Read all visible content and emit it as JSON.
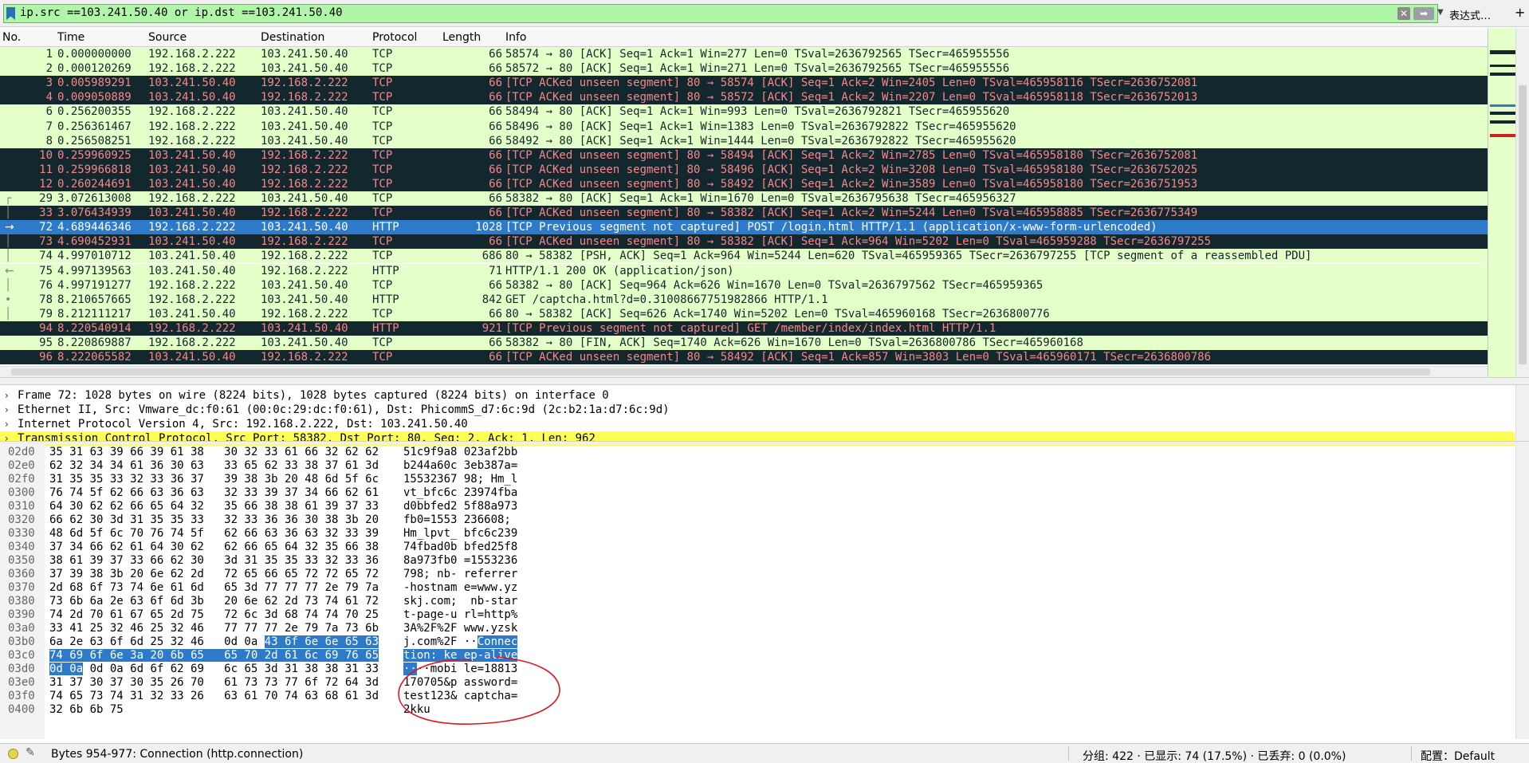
{
  "filter": {
    "text": "ip.src ==103.241.50.40 or ip.dst ==103.241.50.40",
    "expression_label": "表达式…",
    "plus_label": "+"
  },
  "packet_list": {
    "columns": [
      "No.",
      "Time",
      "Source",
      "Destination",
      "Protocol",
      "Length",
      "Info"
    ],
    "rows": [
      {
        "no": "1",
        "time": "0.000000000",
        "src": "192.168.2.222",
        "dst": "103.241.50.40",
        "proto": "TCP",
        "len": "66",
        "info": "58574 → 80 [ACK] Seq=1 Ack=1 Win=277 Len=0 TSval=2636792565 TSecr=465955556",
        "style": "green"
      },
      {
        "no": "2",
        "time": "0.000120269",
        "src": "192.168.2.222",
        "dst": "103.241.50.40",
        "proto": "TCP",
        "len": "66",
        "info": "58572 → 80 [ACK] Seq=1 Ack=1 Win=271 Len=0 TSval=2636792565 TSecr=465955556",
        "style": "green"
      },
      {
        "no": "3",
        "time": "0.005989291",
        "src": "103.241.50.40",
        "dst": "192.168.2.222",
        "proto": "TCP",
        "len": "66",
        "info": "[TCP ACKed unseen segment] 80 → 58574 [ACK] Seq=1 Ack=2 Win=2405 Len=0 TSval=465958116 TSecr=2636752081",
        "style": "dark"
      },
      {
        "no": "4",
        "time": "0.009050889",
        "src": "103.241.50.40",
        "dst": "192.168.2.222",
        "proto": "TCP",
        "len": "66",
        "info": "[TCP ACKed unseen segment] 80 → 58572 [ACK] Seq=1 Ack=2 Win=2207 Len=0 TSval=465958118 TSecr=2636752013",
        "style": "dark"
      },
      {
        "no": "6",
        "time": "0.256200355",
        "src": "192.168.2.222",
        "dst": "103.241.50.40",
        "proto": "TCP",
        "len": "66",
        "info": "58494 → 80 [ACK] Seq=1 Ack=1 Win=993 Len=0 TSval=2636792821 TSecr=465955620",
        "style": "green"
      },
      {
        "no": "7",
        "time": "0.256361467",
        "src": "192.168.2.222",
        "dst": "103.241.50.40",
        "proto": "TCP",
        "len": "66",
        "info": "58496 → 80 [ACK] Seq=1 Ack=1 Win=1383 Len=0 TSval=2636792822 TSecr=465955620",
        "style": "green"
      },
      {
        "no": "8",
        "time": "0.256508251",
        "src": "192.168.2.222",
        "dst": "103.241.50.40",
        "proto": "TCP",
        "len": "66",
        "info": "58492 → 80 [ACK] Seq=1 Ack=1 Win=1444 Len=0 TSval=2636792822 TSecr=465955620",
        "style": "green"
      },
      {
        "no": "10",
        "time": "0.259960925",
        "src": "103.241.50.40",
        "dst": "192.168.2.222",
        "proto": "TCP",
        "len": "66",
        "info": "[TCP ACKed unseen segment] 80 → 58494 [ACK] Seq=1 Ack=2 Win=2785 Len=0 TSval=465958180 TSecr=2636752081",
        "style": "dark"
      },
      {
        "no": "11",
        "time": "0.259966818",
        "src": "103.241.50.40",
        "dst": "192.168.2.222",
        "proto": "TCP",
        "len": "66",
        "info": "[TCP ACKed unseen segment] 80 → 58496 [ACK] Seq=1 Ack=2 Win=3208 Len=0 TSval=465958180 TSecr=2636752025",
        "style": "dark"
      },
      {
        "no": "12",
        "time": "0.260244691",
        "src": "103.241.50.40",
        "dst": "192.168.2.222",
        "proto": "TCP",
        "len": "66",
        "info": "[TCP ACKed unseen segment] 80 → 58492 [ACK] Seq=1 Ack=2 Win=3589 Len=0 TSval=465958180 TSecr=2636751953",
        "style": "dark"
      },
      {
        "no": "29",
        "time": "3.072613008",
        "src": "192.168.2.222",
        "dst": "103.241.50.40",
        "proto": "TCP",
        "len": "66",
        "info": "58382 → 80 [ACK] Seq=1 Ack=1 Win=1670 Len=0 TSval=2636795638 TSecr=465956327",
        "style": "green"
      },
      {
        "no": "33",
        "time": "3.076434939",
        "src": "103.241.50.40",
        "dst": "192.168.2.222",
        "proto": "TCP",
        "len": "66",
        "info": "[TCP ACKed unseen segment] 80 → 58382 [ACK] Seq=1 Ack=2 Win=5244 Len=0 TSval=465958885 TSecr=2636775349",
        "style": "dark"
      },
      {
        "no": "72",
        "time": "4.689446346",
        "src": "192.168.2.222",
        "dst": "103.241.50.40",
        "proto": "HTTP",
        "len": "1028",
        "info": "[TCP Previous segment not captured] POST /login.html HTTP/1.1  (application/x-www-form-urlencoded)",
        "style": "sel"
      },
      {
        "no": "73",
        "time": "4.690452931",
        "src": "103.241.50.40",
        "dst": "192.168.2.222",
        "proto": "TCP",
        "len": "66",
        "info": "[TCP ACKed unseen segment] 80 → 58382 [ACK] Seq=1 Ack=964 Win=5202 Len=0 TSval=465959288 TSecr=2636797255",
        "style": "dark"
      },
      {
        "no": "74",
        "time": "4.997010712",
        "src": "103.241.50.40",
        "dst": "192.168.2.222",
        "proto": "TCP",
        "len": "686",
        "info": "80 → 58382 [PSH, ACK] Seq=1 Ack=964 Win=5244 Len=620 TSval=465959365 TSecr=2636797255 [TCP segment of a reassembled PDU]",
        "style": "green"
      },
      {
        "no": "75",
        "time": "4.997139563",
        "src": "103.241.50.40",
        "dst": "192.168.2.222",
        "proto": "HTTP",
        "len": "71",
        "info": "HTTP/1.1 200 OK  (application/json)",
        "style": "green"
      },
      {
        "no": "76",
        "time": "4.997191277",
        "src": "192.168.2.222",
        "dst": "103.241.50.40",
        "proto": "TCP",
        "len": "66",
        "info": "58382 → 80 [ACK] Seq=964 Ack=626 Win=1670 Len=0 TSval=2636797562 TSecr=465959365",
        "style": "green"
      },
      {
        "no": "78",
        "time": "8.210657665",
        "src": "192.168.2.222",
        "dst": "103.241.50.40",
        "proto": "HTTP",
        "len": "842",
        "info": "GET /captcha.html?d=0.31008667751982866 HTTP/1.1",
        "style": "green"
      },
      {
        "no": "79",
        "time": "8.212111217",
        "src": "103.241.50.40",
        "dst": "192.168.2.222",
        "proto": "TCP",
        "len": "66",
        "info": "80 → 58382 [ACK] Seq=626 Ack=1740 Win=5202 Len=0 TSval=465960168 TSecr=2636800776",
        "style": "green"
      },
      {
        "no": "94",
        "time": "8.220540914",
        "src": "192.168.2.222",
        "dst": "103.241.50.40",
        "proto": "HTTP",
        "len": "921",
        "info": "[TCP Previous segment not captured] GET /member/index/index.html HTTP/1.1",
        "style": "dark"
      },
      {
        "no": "95",
        "time": "8.220869887",
        "src": "192.168.2.222",
        "dst": "103.241.50.40",
        "proto": "TCP",
        "len": "66",
        "info": "58382 → 80 [FIN, ACK] Seq=1740 Ack=626 Win=1670 Len=0 TSval=2636800786 TSecr=465960168",
        "style": "green"
      },
      {
        "no": "96",
        "time": "8.222065582",
        "src": "103.241.50.40",
        "dst": "192.168.2.222",
        "proto": "TCP",
        "len": "66",
        "info": "[TCP ACKed unseen segment] 80 → 58492 [ACK] Seq=1 Ack=857 Win=3803 Len=0 TSval=465960171 TSecr=2636800786",
        "style": "dark"
      }
    ]
  },
  "details": [
    {
      "text": "Frame 72: 1028 bytes on wire (8224 bits), 1028 bytes captured (8224 bits) on interface 0",
      "highlight": false
    },
    {
      "text": "Ethernet II, Src: Vmware_dc:f0:61 (00:0c:29:dc:f0:61), Dst: PhicommS_d7:6c:9d (2c:b2:1a:d7:6c:9d)",
      "highlight": false
    },
    {
      "text": "Internet Protocol Version 4, Src: 192.168.2.222, Dst: 103.241.50.40",
      "highlight": false
    },
    {
      "text": "Transmission Control Protocol, Src Port: 58382, Dst Port: 80, Seq: 2, Ack: 1, Len: 962",
      "highlight": true
    }
  ],
  "bytes": [
    {
      "off": "02d0",
      "hex": [
        {
          "t": "35 31 63 39 66 39 61 38   30 32 33 61 66 32 62 62"
        }
      ],
      "ascii": [
        {
          "t": "51c9f9a8 023af2bb"
        }
      ]
    },
    {
      "off": "02e0",
      "hex": [
        {
          "t": "62 32 34 34 61 36 30 63   33 65 62 33 38 37 61 3d"
        }
      ],
      "ascii": [
        {
          "t": "b244a60c 3eb387a="
        }
      ]
    },
    {
      "off": "02f0",
      "hex": [
        {
          "t": "31 35 35 33 32 33 36 37   39 38 3b 20 48 6d 5f 6c"
        }
      ],
      "ascii": [
        {
          "t": "15532367 98; Hm_l"
        }
      ]
    },
    {
      "off": "0300",
      "hex": [
        {
          "t": "76 74 5f 62 66 63 36 63   32 33 39 37 34 66 62 61"
        }
      ],
      "ascii": [
        {
          "t": "vt_bfc6c 23974fba"
        }
      ]
    },
    {
      "off": "0310",
      "hex": [
        {
          "t": "64 30 62 62 66 65 64 32   35 66 38 38 61 39 37 33"
        }
      ],
      "ascii": [
        {
          "t": "d0bbfed2 5f88a973"
        }
      ]
    },
    {
      "off": "0320",
      "hex": [
        {
          "t": "66 62 30 3d 31 35 35 33   32 33 36 36 30 38 3b 20"
        }
      ],
      "ascii": [
        {
          "t": "fb0=1553 236608; "
        }
      ]
    },
    {
      "off": "0330",
      "hex": [
        {
          "t": "48 6d 5f 6c 70 76 74 5f   62 66 63 36 63 32 33 39"
        }
      ],
      "ascii": [
        {
          "t": "Hm_lpvt_ bfc6c239"
        }
      ]
    },
    {
      "off": "0340",
      "hex": [
        {
          "t": "37 34 66 62 61 64 30 62   62 66 65 64 32 35 66 38"
        }
      ],
      "ascii": [
        {
          "t": "74fbad0b bfed25f8"
        }
      ]
    },
    {
      "off": "0350",
      "hex": [
        {
          "t": "38 61 39 37 33 66 62 30   3d 31 35 35 33 32 33 36"
        }
      ],
      "ascii": [
        {
          "t": "8a973fb0 =1553236"
        }
      ]
    },
    {
      "off": "0360",
      "hex": [
        {
          "t": "37 39 38 3b 20 6e 62 2d   72 65 66 65 72 72 65 72"
        }
      ],
      "ascii": [
        {
          "t": "798; nb- referrer"
        }
      ]
    },
    {
      "off": "0370",
      "hex": [
        {
          "t": "2d 68 6f 73 74 6e 61 6d   65 3d 77 77 77 2e 79 7a"
        }
      ],
      "ascii": [
        {
          "t": "-hostnam e=www.yz"
        }
      ]
    },
    {
      "off": "0380",
      "hex": [
        {
          "t": "73 6b 6a 2e 63 6f 6d 3b   20 6e 62 2d 73 74 61 72"
        }
      ],
      "ascii": [
        {
          "t": "skj.com;  nb-star"
        }
      ]
    },
    {
      "off": "0390",
      "hex": [
        {
          "t": "74 2d 70 61 67 65 2d 75   72 6c 3d 68 74 74 70 25"
        }
      ],
      "ascii": [
        {
          "t": "t-page-u rl=http%"
        }
      ]
    },
    {
      "off": "03a0",
      "hex": [
        {
          "t": "33 41 25 32 46 25 32 46   77 77 77 2e 79 7a 73 6b"
        }
      ],
      "ascii": [
        {
          "t": "3A%2F%2F www.yzsk"
        }
      ]
    },
    {
      "off": "03b0",
      "hex": [
        {
          "t": "6a 2e 63 6f 6d 25 32 46   0d 0a "
        },
        {
          "t": "43 6f 6e 6e 65 63",
          "sel": true
        }
      ],
      "ascii": [
        {
          "t": "j.com%2F ··"
        },
        {
          "t": "Connec",
          "sel": true
        }
      ]
    },
    {
      "off": "03c0",
      "hex": [
        {
          "t": "74 69 6f 6e 3a 20 6b 65   65 70 2d 61 6c 69 76 65",
          "sel": true
        }
      ],
      "ascii": [
        {
          "t": "tion: ke ep-alive",
          "sel": true
        }
      ]
    },
    {
      "off": "03d0",
      "hex": [
        {
          "t": "0d 0a",
          "sel": true
        },
        {
          "t": " 0d 0a 6d 6f 62 69   6c 65 3d 31 38 38 31 33"
        }
      ],
      "ascii": [
        {
          "t": "··",
          "sel": true
        },
        {
          "t": "··mobi le=18813"
        }
      ]
    },
    {
      "off": "03e0",
      "hex": [
        {
          "t": "31 37 30 37 30 35 26 70   61 73 73 77 6f 72 64 3d"
        }
      ],
      "ascii": [
        {
          "t": "170705&p assword="
        }
      ]
    },
    {
      "off": "03f0",
      "hex": [
        {
          "t": "74 65 73 74 31 32 33 26   63 61 70 74 63 68 61 3d"
        }
      ],
      "ascii": [
        {
          "t": "test123& captcha="
        }
      ]
    },
    {
      "off": "0400",
      "hex": [
        {
          "t": "32 6b 6b 75"
        }
      ],
      "ascii": [
        {
          "t": "2kku"
        }
      ]
    }
  ],
  "status": {
    "left": "Bytes 954-977: Connection (http.connection)",
    "middle": "分组: 422 · 已显示: 74 (17.5%) · 已丢弃: 0 (0.0%)",
    "right": "配置：Default"
  },
  "colors": {
    "green_row": "#e4ffc7",
    "dark_row": "#12272e",
    "dark_row_text": "#f78787",
    "selected": "#2c7ac9",
    "filter_valid": "#b0f5a8",
    "highlight": "#ffff55",
    "annotation": "#e0141e"
  },
  "icons": [
    "bookmark-icon",
    "clear-icon",
    "apply-arrow-icon",
    "dropdown-icon",
    "expand-arrow-icon",
    "status-led-icon",
    "edit-icon"
  ]
}
